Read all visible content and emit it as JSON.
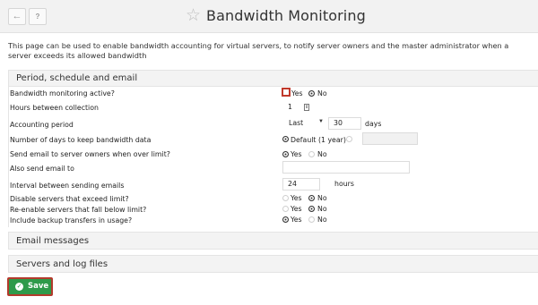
{
  "header": {
    "title": "Bandwidth Monitoring",
    "back_icon": "←",
    "help_icon": "?"
  },
  "intro": "This page can be used to enable bandwidth accounting for virtual servers, to notify server owners and the master administrator when a server exceeds its allowed bandwidth",
  "sections": {
    "period": "Period, schedule and email",
    "email": "Email messages",
    "servers": "Servers and log files"
  },
  "form": {
    "monitoring_active": {
      "label": "Bandwidth monitoring active?",
      "yes": "Yes",
      "no": "No",
      "selected": "No"
    },
    "hours_between": {
      "label": "Hours between collection",
      "value": "1"
    },
    "accounting_period": {
      "label": "Accounting period",
      "select_value": "Last",
      "days_value": "30",
      "unit": "days"
    },
    "days_to_keep": {
      "label": "Number of days to keep bandwidth data",
      "default_option": "Default (1 year)",
      "custom_value": ""
    },
    "send_email_owners": {
      "label": "Send email to server owners when over limit?",
      "yes": "Yes",
      "no": "No",
      "selected": "Yes"
    },
    "also_send_email": {
      "label": "Also send email to",
      "value": ""
    },
    "interval_emails": {
      "label": "Interval between sending emails",
      "value": "24",
      "unit": "hours"
    },
    "disable_servers": {
      "label": "Disable servers that exceed limit?",
      "yes": "Yes",
      "no": "No",
      "selected": "No"
    },
    "reenable_servers": {
      "label": "Re-enable servers that fall below limit?",
      "yes": "Yes",
      "no": "No",
      "selected": "No"
    },
    "include_backup": {
      "label": "Include backup transfers in usage?",
      "yes": "Yes",
      "no": "No",
      "selected": "Yes"
    }
  },
  "buttons": {
    "save": "Save"
  },
  "colors": {
    "save_green": "#2e9a4a",
    "focus_red": "#c0392b"
  }
}
